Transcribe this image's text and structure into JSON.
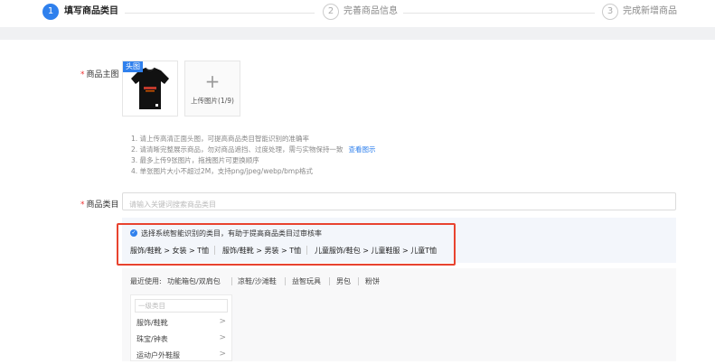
{
  "steps": [
    {
      "num": "1",
      "label": "填写商品类目"
    },
    {
      "num": "2",
      "label": "完善商品信息"
    },
    {
      "num": "3",
      "label": "完成新增商品"
    }
  ],
  "form": {
    "main_image_label": "商品主图",
    "category_label": "商品类目",
    "required_mark": "*"
  },
  "image": {
    "tag": "头图",
    "upload_plus": "+",
    "upload_text": "上传图片(1/9)"
  },
  "tips": {
    "line1": "1. 请上传高清正面头图，可提高商品类目智能识别的准确率",
    "line2": "2. 请清晰完整展示商品，勿对商品遮挡、过度处理，需与实物保持一致",
    "line2_link": "查看图示",
    "line3": "3. 最多上传9张图片，拖拽图片可更换顺序",
    "line4": "4. 单张图片大小不超过2M，支持png/jpeg/webp/bmp格式"
  },
  "category_input": {
    "placeholder": "请输入关键词搜索商品类目",
    "value": ""
  },
  "suggestion": {
    "title": "选择系统智能识别的类目，有助于提高商品类目过审核率",
    "paths": [
      "服饰/鞋靴 > 女装 > T恤",
      "服饰/鞋靴 > 男装 > T恤",
      "儿童服饰/鞋包 > 儿童鞋服 > 儿童T恤"
    ]
  },
  "recent": {
    "label": "最近使用:",
    "items": [
      "功能箱包/双肩包",
      "凉鞋/沙滩鞋",
      "益智玩具",
      "男包",
      "粉饼"
    ]
  },
  "level1": {
    "search_placeholder": "一级类目",
    "items": [
      "服饰/鞋靴",
      "珠宝/钟表",
      "运动户外鞋服"
    ]
  },
  "colors": {
    "accent": "#2f80ed",
    "highlight_border": "#e8432f"
  }
}
